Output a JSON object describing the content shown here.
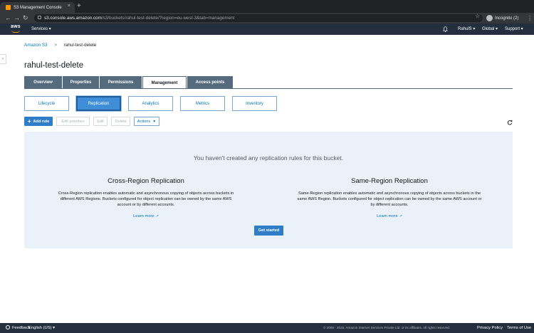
{
  "browser": {
    "tab_title": "S3 Management Console",
    "tab_close": "×",
    "new_tab": "+",
    "url_host": "s3.console.aws.amazon.com",
    "url_path": "/s3/buckets/rahul-test-delete/?region=eu-west-3&tab=management",
    "incognito_label": "Incognito (2)",
    "traffic_colors": [
      "#ff5f57",
      "#febc2e",
      "#28c840"
    ]
  },
  "aws_header": {
    "logo_text": "aws",
    "services": "Services ▾",
    "user": "RahulS ▾",
    "region": "Global ▾",
    "support": "Support ▾"
  },
  "breadcrumb": {
    "root": "Amazon S3",
    "separator": ">",
    "current": "rahul-test-delete"
  },
  "page_title": "rahul-test-delete",
  "main_tabs": [
    {
      "label": "Overview"
    },
    {
      "label": "Properties"
    },
    {
      "label": "Permissions"
    },
    {
      "label": "Management"
    },
    {
      "label": "Access points"
    }
  ],
  "sub_tabs": [
    {
      "label": "Lifecycle"
    },
    {
      "label": "Replication"
    },
    {
      "label": "Analytics"
    },
    {
      "label": "Metrics"
    },
    {
      "label": "Inventory"
    }
  ],
  "toolbar": {
    "add_rule": "Add rule",
    "edit_priorities": "Edit priorities",
    "edit": "Edit",
    "delete": "Delete",
    "actions": "Actions"
  },
  "empty_state": {
    "heading": "You haven't created any replication rules for this bucket.",
    "cross_region": {
      "title": "Cross-Region Replication",
      "description": "Cross-Region replication enables automatic and asynchronous copying of objects across buckets in different AWS Regions. Buckets configured for object replication can be owned by the same AWS account or by different accounts.",
      "link": "Learn more"
    },
    "same_region": {
      "title": "Same-Region Replication",
      "description": "Same-Region replication enables automatic and asynchronous copying of objects across buckets in the same AWS Region. Buckets configured for object replication can be owned by the same AWS account or by different accounts.",
      "link": "Learn more"
    },
    "get_started": "Get started"
  },
  "footer": {
    "feedback": "Feedback",
    "language": "English (US) ▾",
    "copyright": "© 2008 - 2020, Amazon Internet Services Private Ltd. or its affiliates. All rights reserved.",
    "privacy": "Privacy Policy",
    "terms": "Terms of Use"
  }
}
